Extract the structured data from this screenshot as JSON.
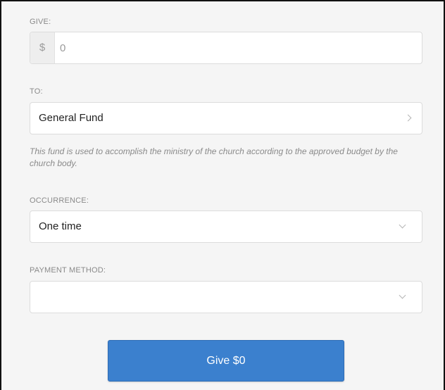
{
  "give": {
    "label": "GIVE:",
    "currency_symbol": "$",
    "amount_placeholder": "0"
  },
  "to": {
    "label": "TO:",
    "selected_fund": "General Fund",
    "fund_description": "This fund is used to accomplish the ministry of the church according to the approved budget by the church body."
  },
  "occurrence": {
    "label": "OCCURRENCE:",
    "selected": "One time"
  },
  "payment_method": {
    "label": "PAYMENT METHOD:",
    "selected": ""
  },
  "submit": {
    "label": "Give $0"
  },
  "colors": {
    "background": "#f5f5f5",
    "button": "#3b80ce",
    "muted_text": "#8a8a8a"
  },
  "icons": {
    "fund_selector": "chevron-right-icon",
    "dropdown": "chevron-down-icon"
  }
}
